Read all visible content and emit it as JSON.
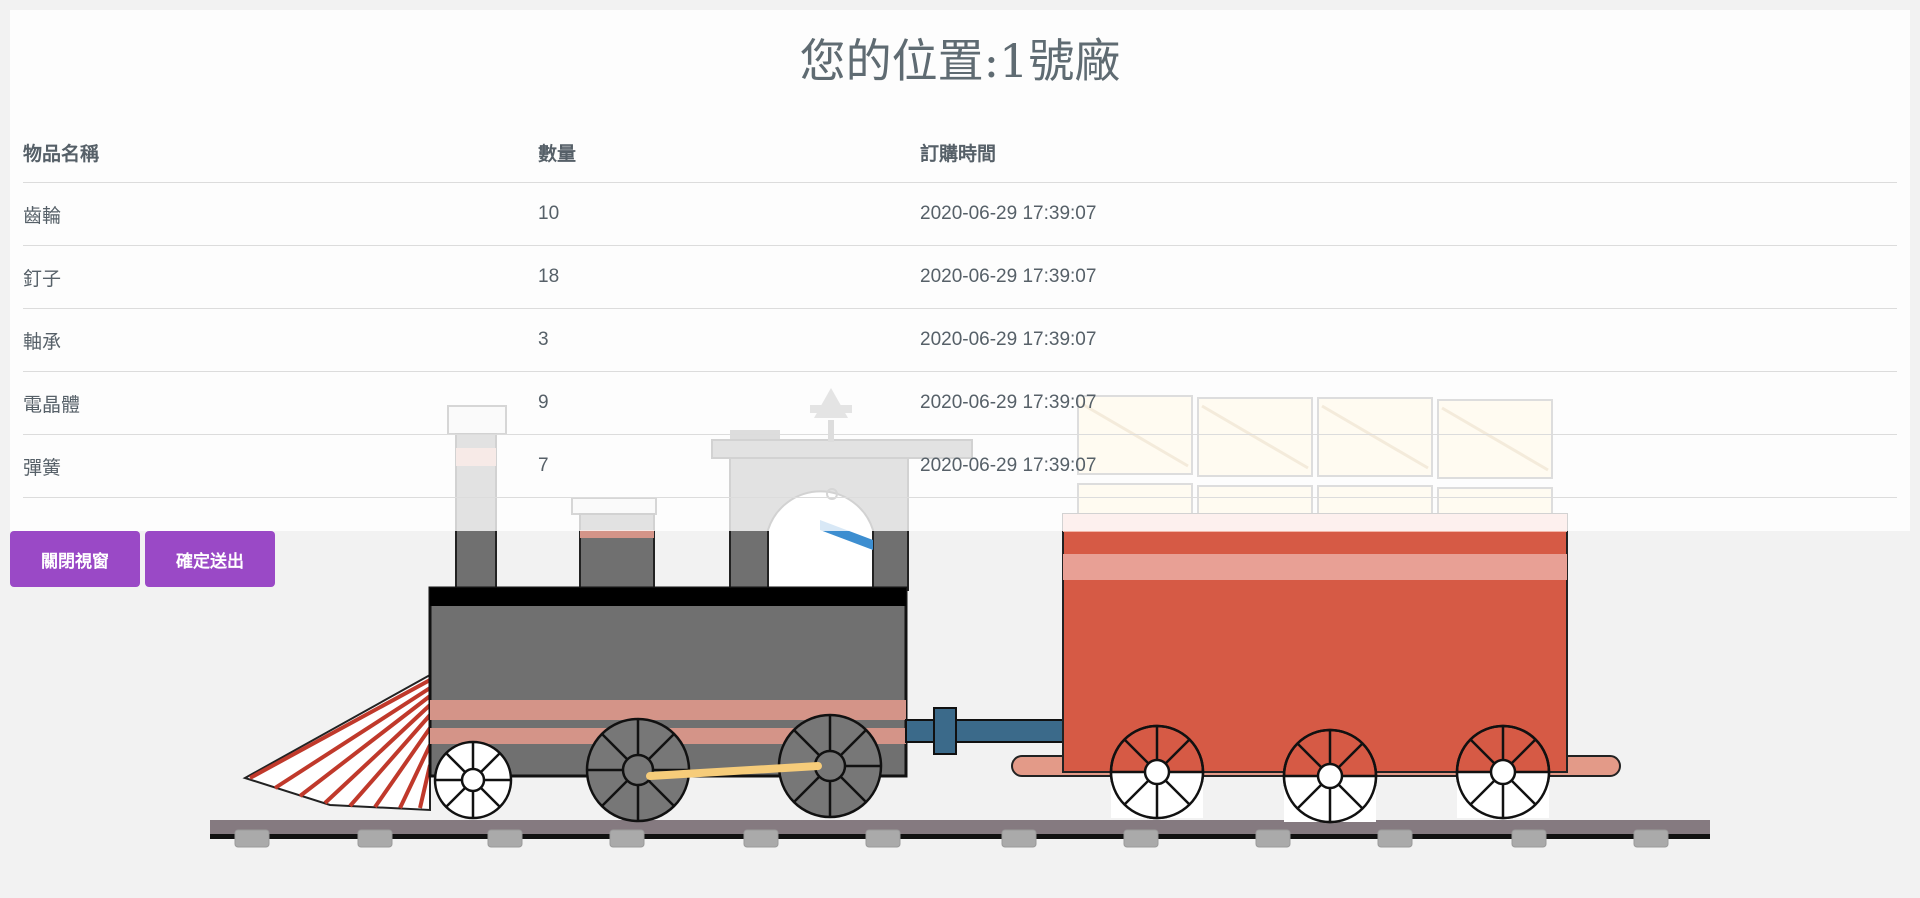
{
  "page": {
    "title": "您的位置:1號廠"
  },
  "table": {
    "headers": [
      "物品名稱",
      "數量",
      "訂購時間"
    ],
    "rows": [
      [
        "齒輪",
        "10",
        "2020-06-29 17:39:07"
      ],
      [
        "釘子",
        "18",
        "2020-06-29 17:39:07"
      ],
      [
        "軸承",
        "3",
        "2020-06-29 17:39:07"
      ],
      [
        "電晶體",
        "9",
        "2020-06-29 17:39:07"
      ],
      [
        "彈簧",
        "7",
        "2020-06-29 17:39:07"
      ]
    ]
  },
  "buttons": {
    "close_label": "關閉視窗",
    "submit_label": "確定送出"
  },
  "colors": {
    "button": "#9a49c6",
    "locomotive_body": "#707070",
    "tender": "#d65a45",
    "stripe": "#d49488",
    "coupler": "#3b6a8a",
    "crate": "#fde9b8"
  },
  "illustration": {
    "name": "train-illustration"
  }
}
